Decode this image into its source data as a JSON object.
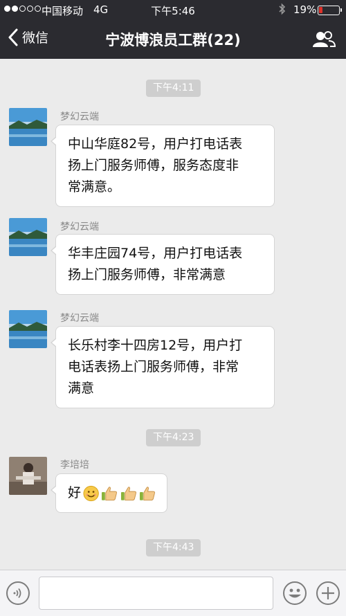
{
  "status": {
    "carrier": "中国移动",
    "network": "4G",
    "time": "下午5:46",
    "battery": "19%",
    "battery_level": 0.19
  },
  "header": {
    "back_label": "微信",
    "title": "宁波博浪员工群(22)"
  },
  "timestamps": [
    "下午4:11",
    "下午4:23",
    "下午4:43"
  ],
  "messages": [
    {
      "sender": "梦幻云端",
      "lines": [
        "中山华庭82号，用户打电话表",
        "扬上门服务师傅，服务态度非",
        "常满意。"
      ]
    },
    {
      "sender": "梦幻云端",
      "lines": [
        "华丰庄园74号，用户打电话表",
        "扬上门服务师傅，非常满意"
      ]
    },
    {
      "sender": "梦幻云端",
      "lines": [
        "长乐村李十四房12号，用户打",
        "电话表扬上门服务师傅，非常",
        "满意"
      ]
    },
    {
      "sender": "李培培",
      "text": "好"
    }
  ],
  "colors": {
    "header_bg": "#2b2b30",
    "chat_bg": "#ebebeb",
    "battery_low": "#e0322a"
  }
}
